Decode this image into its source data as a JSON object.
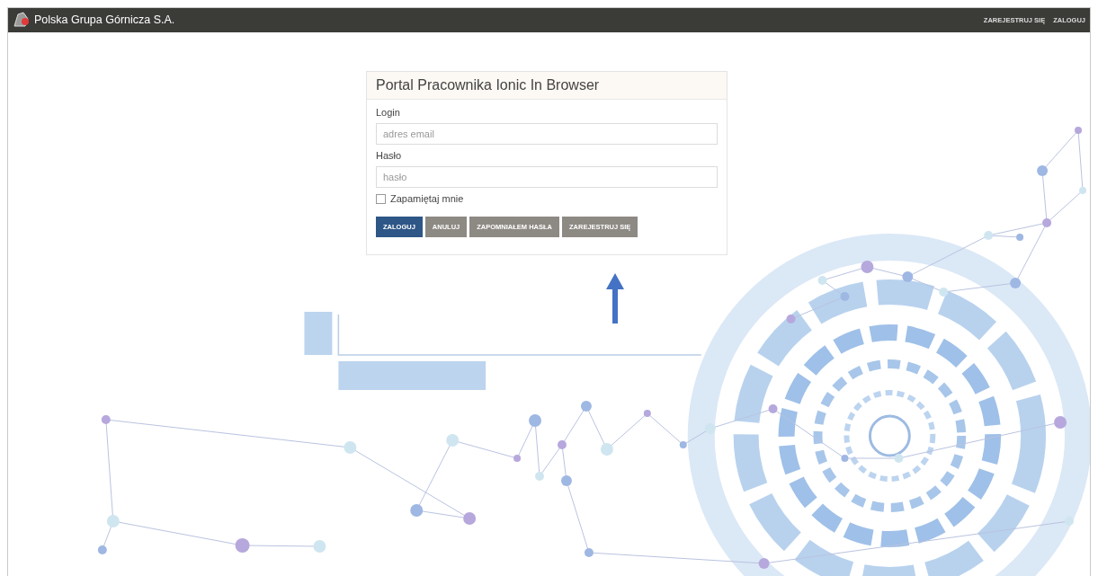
{
  "navbar": {
    "brand": "Polska Grupa Górnicza S.A.",
    "links": [
      "ZAREJESTRUJ SIĘ",
      "ZALOGUJ"
    ]
  },
  "login_card": {
    "title": "Portal Pracownika Ionic In Browser",
    "fields": [
      {
        "label": "Login",
        "placeholder": "adres email"
      },
      {
        "label": "Hasło",
        "placeholder": "hasło"
      }
    ],
    "remember": {
      "label": "Zapamiętaj mnie",
      "checked": false
    },
    "buttons": [
      {
        "label": "ZALOGUJ",
        "kind": "primary"
      },
      {
        "label": "ANULUJ",
        "kind": "secondary"
      },
      {
        "label": "ZAPOMNIAŁEM HASŁA",
        "kind": "secondary"
      },
      {
        "label": "ZAREJESTRUJ SIĘ",
        "kind": "secondary"
      }
    ]
  }
}
